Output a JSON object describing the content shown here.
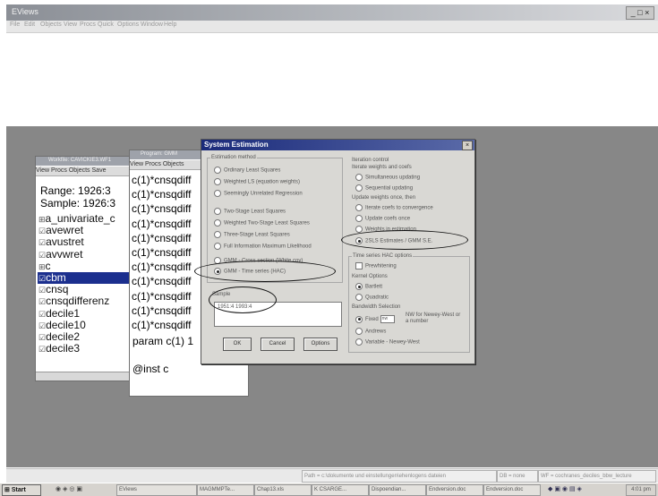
{
  "app": {
    "title": "EViews",
    "window_controls": "_ □ ×",
    "menu": [
      "File",
      "Edit",
      "Objects",
      "View",
      "Procs",
      "Quick",
      "Options",
      "Window",
      "Help"
    ]
  },
  "workfile": {
    "title": "Workfile: CAVICKIE3.WF1",
    "toolbar": "View Procs Objects Save",
    "range": "Range:  1926:3",
    "sample": "Sample: 1926:3",
    "objects": [
      {
        "icon": "⊞",
        "name": "a_univariate_c"
      },
      {
        "icon": "☑",
        "name": "avewret"
      },
      {
        "icon": "☑",
        "name": "avustret"
      },
      {
        "icon": "☑",
        "name": "avvwret"
      },
      {
        "icon": "⊞",
        "name": "c"
      },
      {
        "icon": "☑",
        "name": "cbm"
      },
      {
        "icon": "☑",
        "name": "cnsq"
      },
      {
        "icon": "☑",
        "name": "cnsqdifferenz"
      },
      {
        "icon": "☑",
        "name": "decile1"
      },
      {
        "icon": "☑",
        "name": "decile10"
      },
      {
        "icon": "☑",
        "name": "decile2"
      },
      {
        "icon": "☑",
        "name": "decile3"
      }
    ],
    "selected_index": 5
  },
  "program": {
    "title": "Program: GMM",
    "toolbar": "View Procs Objects",
    "lines": [
      "c(1)*cnsqdiff",
      "c(1)*cnsqdiff",
      "c(1)*cnsqdiff",
      "c(1)*cnsqdiff",
      "c(1)*cnsqdiff",
      "c(1)*cnsqdiff",
      "c(1)*cnsqdiff",
      "c(1)*cnsqdiff",
      "c(1)*cnsqdiff",
      "c(1)*cnsqdiff",
      "c(1)*cnsqdiff"
    ],
    "param_line": "param c(1)  1",
    "inst_line": "@inst c"
  },
  "dialog": {
    "title": "System Estimation",
    "close": "×",
    "estimation_method_label": "Estimation method",
    "methods": [
      {
        "label": "Ordinary Least Squares",
        "selected": false
      },
      {
        "label": "Weighted LS  (equation weights)",
        "selected": false
      },
      {
        "label": "Seemingly Unrelated Regression",
        "selected": false
      },
      {
        "label": "Two-Stage Least Squares",
        "selected": false
      },
      {
        "label": "Weighted Two-Stage Least Squares",
        "selected": false
      },
      {
        "label": "Three-Stage Least Squares",
        "selected": false
      },
      {
        "label": "Full Information Maximum Likelihood",
        "selected": false
      },
      {
        "label": "GMM - Cross section (White cov)",
        "selected": false
      },
      {
        "label": "GMM - Time series  (HAC)",
        "selected": true
      }
    ],
    "sample_label": "Sample",
    "sample_value": "1951:4 1993:4",
    "buttons": {
      "ok": "OK",
      "cancel": "Cancel",
      "options": "Options"
    },
    "iteration_label": "Iteration control",
    "iterate_label": "Iterate weights and coefs",
    "iterate_options": [
      {
        "label": "Simultaneous updating",
        "selected": false
      },
      {
        "label": "Sequential updating",
        "selected": false
      }
    ],
    "update_label": "Update weights once, then",
    "update_options": [
      {
        "label": "Iterate coefs to convergence",
        "selected": false
      },
      {
        "label": "Update coefs once",
        "selected": false
      },
      {
        "label": "Weights in estimation",
        "selected": false
      },
      {
        "label": "2SLS Estimates / GMM S.E.",
        "selected": true
      }
    ],
    "timeseries_label": "Time series HAC options",
    "prewhitening_label": "Prewhitening",
    "kernel_label": "Kernel Options",
    "kernel_options": [
      {
        "label": "Bartlett",
        "selected": true
      },
      {
        "label": "Quadratic",
        "selected": false
      }
    ],
    "bandwidth_label": "Bandwidth Selection",
    "bandwidth_options": [
      {
        "label": "Fixed",
        "selected": true
      },
      {
        "label": "Andrews",
        "selected": false
      },
      {
        "label": "Variable - Newey-West",
        "selected": false
      }
    ],
    "bandwidth_input": "nw",
    "bandwidth_note": "NW for Newey-West or a number"
  },
  "statusbar": {
    "path": "Path = c:\\dokumente und einstellungen\\ehenlogens dateien",
    "db": "DB = none",
    "wf": "WF = cochranes_deciles_bbw_lecture"
  },
  "taskbar": {
    "start": "Start",
    "tasks": [
      "EViews",
      "MAGMMPTe...",
      "Chap13.xls",
      "K CSARGE...",
      "Dispoendian...",
      "Endversion.doc",
      "Endversion.doc"
    ],
    "clock": "4:01 pm"
  }
}
